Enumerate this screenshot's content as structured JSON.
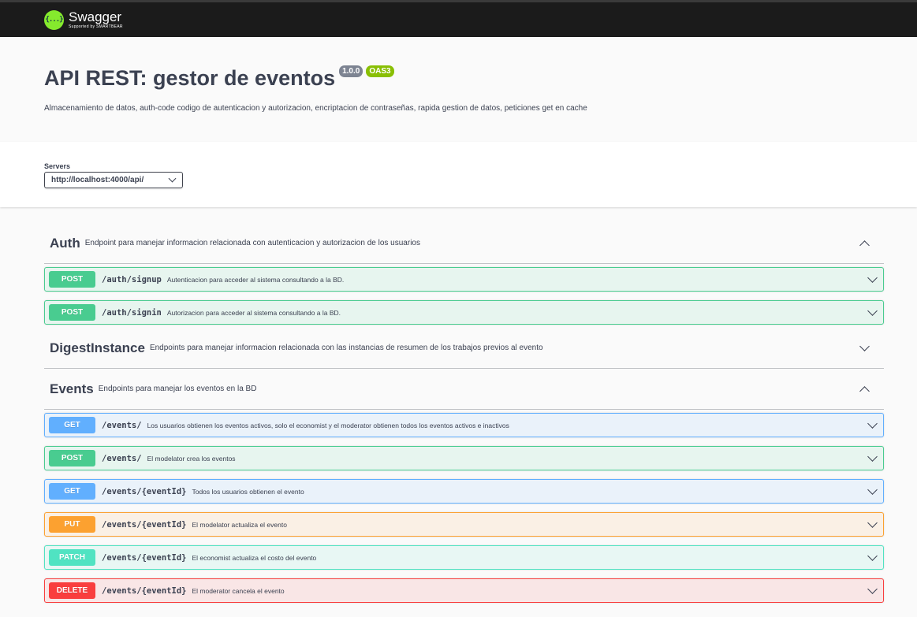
{
  "topbar": {
    "logo_mark": "{...}",
    "logo_title": "Swagger",
    "logo_subtitle": "Supported by SMARTBEAR"
  },
  "info": {
    "title": "API REST: gestor de eventos",
    "version": "1.0.0",
    "oas_badge": "OAS3",
    "description": "Almacenamiento de datos, auth-code codigo de autenticacion y autorizacion, encriptacion de contraseñas, rapida gestion de datos, peticiones get en cache"
  },
  "servers": {
    "label": "Servers",
    "selected": "http://localhost:4000/api/"
  },
  "tags": [
    {
      "name": "Auth",
      "description": "Endpoint para manejar informacion relacionada con autenticacion y autorizacion de los usuarios",
      "expanded": true,
      "operations": [
        {
          "method": "POST",
          "path": "/auth/signup",
          "summary": "Autenticacion para acceder al sistema consultando a la BD."
        },
        {
          "method": "POST",
          "path": "/auth/signin",
          "summary": "Autorizacion para acceder al sistema consultando a la BD."
        }
      ]
    },
    {
      "name": "DigestInstance",
      "description": "Endpoints para manejar informacion relacionada con las instancias de resumen de los trabajos previos al evento",
      "expanded": false,
      "operations": []
    },
    {
      "name": "Events",
      "description": "Endpoints para manejar los eventos en la BD",
      "expanded": true,
      "operations": [
        {
          "method": "GET",
          "path": "/events/",
          "summary": "Los usuarios obtienen los eventos activos, solo el economist y el moderator obtienen todos los eventos activos e inactivos"
        },
        {
          "method": "POST",
          "path": "/events/",
          "summary": "El modelator crea los eventos"
        },
        {
          "method": "GET",
          "path": "/events/{eventId}",
          "summary": "Todos los usuarios obtienen el evento"
        },
        {
          "method": "PUT",
          "path": "/events/{eventId}",
          "summary": "El modelator actualiza el evento"
        },
        {
          "method": "PATCH",
          "path": "/events/{eventId}",
          "summary": "El economist actualiza el costo del evento"
        },
        {
          "method": "DELETE",
          "path": "/events/{eventId}",
          "summary": "El moderator cancela el evento"
        }
      ]
    }
  ],
  "colors": {
    "post": "#49cc90",
    "get": "#61affe",
    "put": "#fca130",
    "patch": "#50e3c2",
    "delete": "#f93e3e",
    "topbar": "#1b1b1b",
    "logo": "#85ea2d",
    "oas_badge": "#89bf04",
    "version_badge": "#7d8492"
  }
}
